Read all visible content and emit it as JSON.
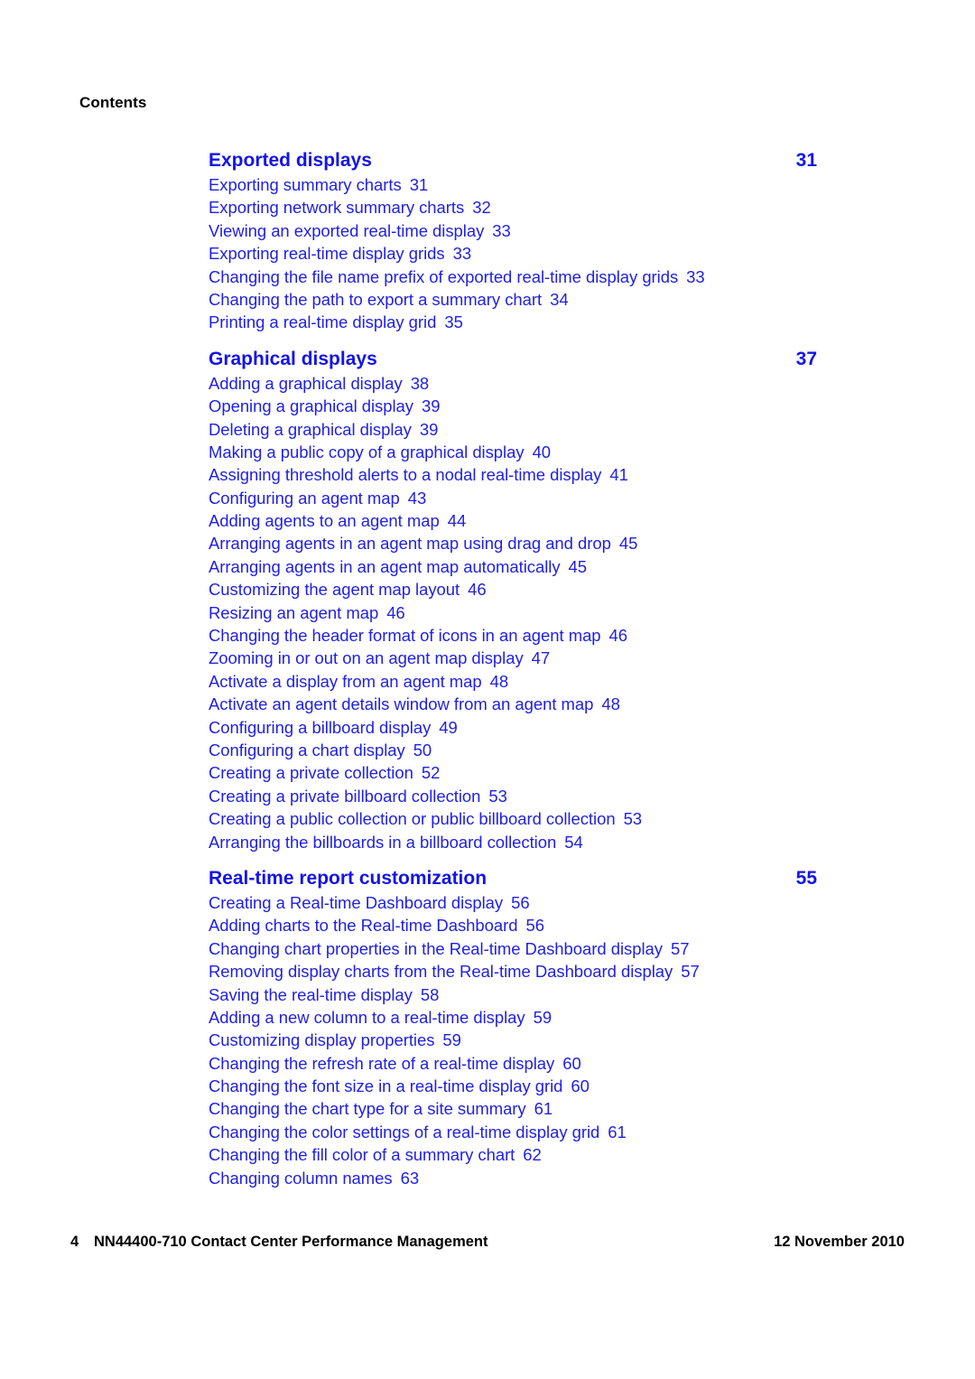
{
  "running_header": "Contents",
  "colors": {
    "link_blue": "#1f1fe6",
    "heading_blue": "#1414e8",
    "text_black": "#000000",
    "page_background": "#ffffff"
  },
  "toc": {
    "sections": [
      {
        "title": "Exported displays",
        "page": "31",
        "entries": [
          {
            "label": "Exporting summary charts",
            "page": "31"
          },
          {
            "label": "Exporting network summary charts",
            "page": "32"
          },
          {
            "label": "Viewing an exported real-time display",
            "page": "33"
          },
          {
            "label": "Exporting real-time display grids",
            "page": "33"
          },
          {
            "label": "Changing the file name prefix of exported real-time display grids",
            "page": "33"
          },
          {
            "label": "Changing the path to export a summary chart",
            "page": "34"
          },
          {
            "label": "Printing a real-time display grid",
            "page": "35"
          }
        ]
      },
      {
        "title": "Graphical displays",
        "page": "37",
        "entries": [
          {
            "label": "Adding a graphical display",
            "page": "38"
          },
          {
            "label": "Opening a graphical display",
            "page": "39"
          },
          {
            "label": "Deleting a graphical display",
            "page": "39"
          },
          {
            "label": "Making a public copy of a graphical display",
            "page": "40"
          },
          {
            "label": "Assigning threshold alerts to a nodal real-time display",
            "page": "41"
          },
          {
            "label": "Configuring an agent map",
            "page": "43"
          },
          {
            "label": "Adding agents to an agent map",
            "page": "44"
          },
          {
            "label": "Arranging agents in an agent map using drag and drop",
            "page": "45"
          },
          {
            "label": "Arranging agents in an agent map automatically",
            "page": "45"
          },
          {
            "label": "Customizing the agent map layout",
            "page": "46"
          },
          {
            "label": "Resizing an agent map",
            "page": "46"
          },
          {
            "label": "Changing the header format of icons in an agent map",
            "page": "46"
          },
          {
            "label": "Zooming in or out on an agent map display",
            "page": "47"
          },
          {
            "label": "Activate a display from an agent map",
            "page": "48"
          },
          {
            "label": "Activate an agent details window from an agent map",
            "page": "48"
          },
          {
            "label": "Configuring a billboard display",
            "page": "49"
          },
          {
            "label": "Configuring a chart display",
            "page": "50"
          },
          {
            "label": "Creating a private collection",
            "page": "52"
          },
          {
            "label": "Creating a private billboard collection",
            "page": "53"
          },
          {
            "label": "Creating a public collection or public billboard collection",
            "page": "53"
          },
          {
            "label": "Arranging the billboards in a billboard collection",
            "page": "54"
          }
        ]
      },
      {
        "title": "Real-time report customization",
        "page": "55",
        "entries": [
          {
            "label": "Creating a Real-time Dashboard display",
            "page": "56"
          },
          {
            "label": "Adding charts to the Real-time Dashboard",
            "page": "56"
          },
          {
            "label": "Changing chart properties in the Real-time Dashboard display",
            "page": "57"
          },
          {
            "label": "Removing display charts from the Real-time Dashboard display",
            "page": "57"
          },
          {
            "label": "Saving the real-time display",
            "page": "58"
          },
          {
            "label": "Adding a new column to a real-time display",
            "page": "59"
          },
          {
            "label": "Customizing display properties",
            "page": "59"
          },
          {
            "label": "Changing the refresh rate of a real-time display",
            "page": "60"
          },
          {
            "label": "Changing the font size in a real-time display grid",
            "page": "60"
          },
          {
            "label": "Changing the chart type for a site summary",
            "page": "61"
          },
          {
            "label": "Changing the color settings of a real-time display grid",
            "page": "61"
          },
          {
            "label": "Changing the fill color of a summary chart",
            "page": "62"
          },
          {
            "label": "Changing column names",
            "page": "63"
          }
        ]
      }
    ]
  },
  "footer": {
    "page_number": "4",
    "document_title": "NN44400-710 Contact Center Performance Management",
    "date": "12 November 2010"
  }
}
